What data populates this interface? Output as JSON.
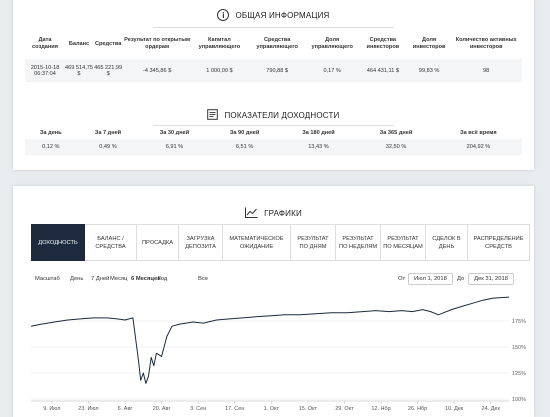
{
  "info": {
    "title": "ОБЩАЯ ИНФОРМАЦИЯ",
    "headers": [
      "Дата создания",
      "Баланс",
      "Средства",
      "Результат по открытым ордерам",
      "Капитал управляющего",
      "Средства управляющего",
      "Доля управляющего",
      "Средства инвесторов",
      "Доля инвесторов",
      "Количество активных инвесторов"
    ],
    "values": [
      "2015-10-18 06:37:04",
      "469 514,75 $",
      "465 221,99 $",
      "-4 345,86 $",
      "1 000,00 $",
      "790,88 $",
      "0,17 %",
      "464 431,11 $",
      "99,83 %",
      "98"
    ]
  },
  "returns": {
    "title": "ПОКАЗАТЕЛИ ДОХОДНОСТИ",
    "headers": [
      "За день",
      "За 7 дней",
      "За 30 дней",
      "За 90 дней",
      "За 180 дней",
      "За 365 дней",
      "За всё время"
    ],
    "values": [
      "0,12 %",
      "0,49 %",
      "6,91 %",
      "6,51 %",
      "13,43 %",
      "32,50 %",
      "204,92 %"
    ]
  },
  "charts": {
    "title": "ГРАФИКИ",
    "tabs": [
      "ДОХОДНОСТЬ",
      "БАЛАНС / СРЕДСТВА",
      "ПРОСАДКА",
      "ЗАГРУЗКА ДЕПОЗИТА",
      "МАТЕМАТИЧЕСКОЕ ОЖИДАНИЕ",
      "РЕЗУЛЬТАТ ПО ДНЯМ",
      "РЕЗУЛЬТАТ ПО НЕДЕЛЯМ",
      "РЕЗУЛЬТАТ ПО МЕСЯЦАМ",
      "СДЕЛОК В ДЕНЬ",
      "РАСПРЕДЕЛЕНИЕ СРЕДСТВ"
    ],
    "zoom_label": "Масштаб",
    "zoom_options": [
      "День",
      "7 Дней",
      "Месяц",
      "6 Месяцев",
      "Год",
      "Все"
    ],
    "zoom_selected": "6 Месяцев",
    "from_label": "От",
    "from_date": "Июл 1, 2018",
    "to_label": "До",
    "to_date": "Дек 31, 2018"
  },
  "chart_data": {
    "type": "line",
    "title": "",
    "xlabel": "",
    "ylabel": "",
    "x_tick_labels": [
      "9. Июл",
      "23. Июл",
      "6. Авг",
      "20. Авг",
      "3. Сен",
      "17. Сен",
      "1. Окт",
      "15. Окт",
      "29. Окт",
      "12. Нбр",
      "26. Нбр",
      "10. Дек",
      "24. Дек"
    ],
    "y_tick_labels": [
      "100%",
      "125%",
      "150%",
      "175%"
    ],
    "ylim": [
      100,
      200
    ],
    "series": [
      {
        "values": [
          {
            "x": "2018-07-01",
            "y": 170
          },
          {
            "x": "2018-07-05",
            "y": 172
          },
          {
            "x": "2018-07-10",
            "y": 174
          },
          {
            "x": "2018-07-15",
            "y": 176
          },
          {
            "x": "2018-07-20",
            "y": 177
          },
          {
            "x": "2018-07-25",
            "y": 178
          },
          {
            "x": "2018-07-30",
            "y": 178
          },
          {
            "x": "2018-08-03",
            "y": 177
          },
          {
            "x": "2018-08-06",
            "y": 176
          },
          {
            "x": "2018-08-09",
            "y": 178
          },
          {
            "x": "2018-08-11",
            "y": 140
          },
          {
            "x": "2018-08-12",
            "y": 118
          },
          {
            "x": "2018-08-13",
            "y": 125
          },
          {
            "x": "2018-08-14",
            "y": 115
          },
          {
            "x": "2018-08-15",
            "y": 122
          },
          {
            "x": "2018-08-16",
            "y": 140
          },
          {
            "x": "2018-08-17",
            "y": 132
          },
          {
            "x": "2018-08-18",
            "y": 144
          },
          {
            "x": "2018-08-20",
            "y": 141
          },
          {
            "x": "2018-08-22",
            "y": 160
          },
          {
            "x": "2018-08-24",
            "y": 170
          },
          {
            "x": "2018-08-27",
            "y": 172
          },
          {
            "x": "2018-09-01",
            "y": 174
          },
          {
            "x": "2018-09-05",
            "y": 173
          },
          {
            "x": "2018-09-10",
            "y": 176
          },
          {
            "x": "2018-09-15",
            "y": 177
          },
          {
            "x": "2018-09-20",
            "y": 178
          },
          {
            "x": "2018-09-25",
            "y": 179
          },
          {
            "x": "2018-10-01",
            "y": 180
          },
          {
            "x": "2018-10-06",
            "y": 181
          },
          {
            "x": "2018-10-12",
            "y": 181
          },
          {
            "x": "2018-10-18",
            "y": 182
          },
          {
            "x": "2018-10-24",
            "y": 183
          },
          {
            "x": "2018-10-30",
            "y": 183
          },
          {
            "x": "2018-11-05",
            "y": 184
          },
          {
            "x": "2018-11-10",
            "y": 185
          },
          {
            "x": "2018-11-15",
            "y": 184
          },
          {
            "x": "2018-11-20",
            "y": 185
          },
          {
            "x": "2018-11-24",
            "y": 184
          },
          {
            "x": "2018-11-28",
            "y": 186
          },
          {
            "x": "2018-12-01",
            "y": 184
          },
          {
            "x": "2018-12-04",
            "y": 181
          },
          {
            "x": "2018-12-06",
            "y": 183
          },
          {
            "x": "2018-12-09",
            "y": 186
          },
          {
            "x": "2018-12-13",
            "y": 189
          },
          {
            "x": "2018-12-17",
            "y": 192
          },
          {
            "x": "2018-12-21",
            "y": 195
          },
          {
            "x": "2018-12-25",
            "y": 197
          },
          {
            "x": "2018-12-31",
            "y": 198
          }
        ]
      }
    ],
    "grid": true,
    "color": "#1d2a3d"
  }
}
